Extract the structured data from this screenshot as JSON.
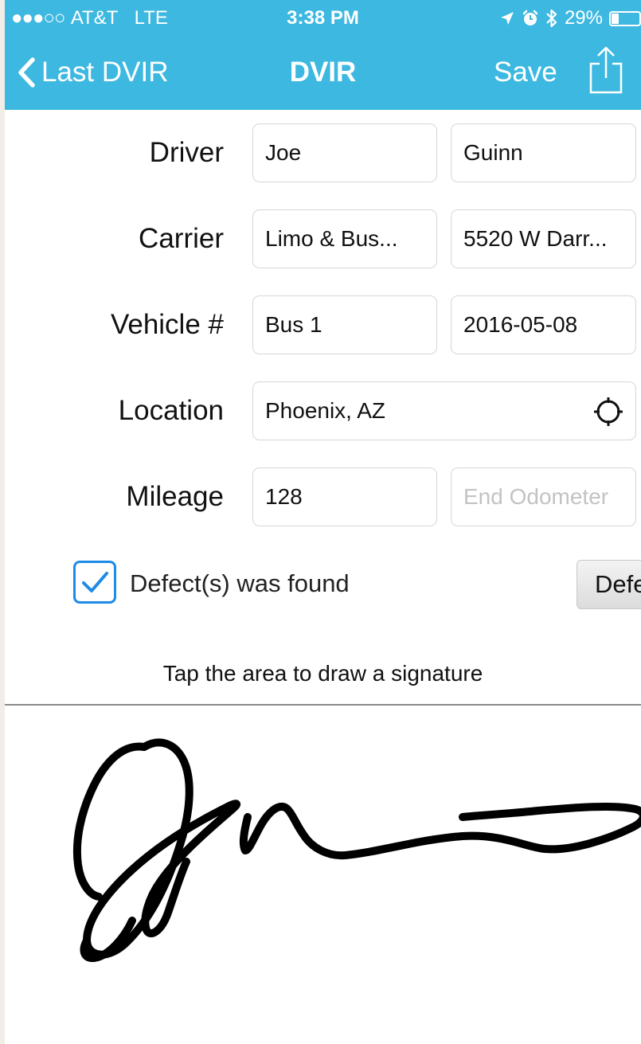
{
  "status_bar": {
    "signal_dots": "●●●○○",
    "carrier": "AT&T",
    "network": "LTE",
    "time": "3:38 PM",
    "battery": "29%",
    "icons": [
      "location-arrow-icon",
      "alarm-icon",
      "bluetooth-icon",
      "battery-icon"
    ]
  },
  "nav": {
    "back_label": "Last DVIR",
    "title": "DVIR",
    "save_label": "Save",
    "share_icon": "share-icon"
  },
  "form": {
    "driver": {
      "label": "Driver",
      "first": "Joe",
      "last": "Guinn"
    },
    "carrier": {
      "label": "Carrier",
      "name": "Limo & Bus...",
      "address": "5520 W Darr..."
    },
    "vehicle": {
      "label": "Vehicle #",
      "number": "Bus 1",
      "date": "2016-05-08"
    },
    "location": {
      "label": "Location",
      "value": "Phoenix, AZ",
      "icon": "crosshair-icon"
    },
    "mileage": {
      "label": "Mileage",
      "start": "128",
      "end_placeholder": "End Odometer"
    }
  },
  "defects": {
    "checked": true,
    "label": "Defect(s) was found",
    "button_label": "Defe"
  },
  "signature": {
    "hint": "Tap the area to draw a signature"
  },
  "colors": {
    "header": "#3db8e1",
    "checkbox_accent": "#1e8be6",
    "placeholder": "#c3c3c3"
  }
}
